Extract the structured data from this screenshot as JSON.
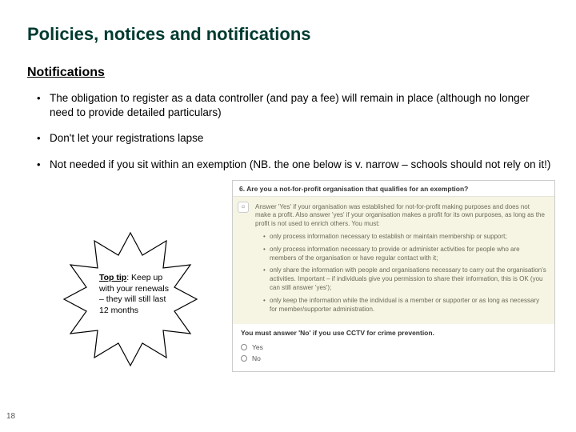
{
  "title": "Policies, notices and notifications",
  "subtitle": "Notifications",
  "bullets": [
    "The obligation to register as a data controller (and pay a fee) will remain in place (although no longer need to provide detailed particulars)",
    "Don't let your registrations lapse",
    "Not needed if you sit within an exemption (NB. the one below is v. narrow – schools should not rely on it!)"
  ],
  "tip": {
    "label": "Top tip",
    "text": ": Keep up with your renewals – they will still last 12 months"
  },
  "screenshot": {
    "question": "6. Are you a not-for-profit organisation that qualifies for an exemption?",
    "intro": "Answer 'Yes' if your organisation was established for not-for-profit making purposes and does not make a profit. Also answer 'yes' if your organisation makes a profit for its own purposes, as long as the profit is not used to enrich others. You must:",
    "subs": [
      "only process information necessary to establish or maintain membership or support;",
      "only process information necessary to provide or administer activities for people who are members of the organisation or have regular contact with it;",
      "only share the information with people and organisations necessary to carry out the organisation's activities. Important – if individuals give you permission to share their information, this is OK (you can still answer 'yes');",
      "only keep the information while the individual is a member or supporter or as long as necessary for member/supporter administration."
    ],
    "warn_prefix": "You must answer 'No' if you use CCTV for crime prevention.",
    "options": {
      "yes": "Yes",
      "no": "No"
    }
  },
  "pagenum": "18"
}
